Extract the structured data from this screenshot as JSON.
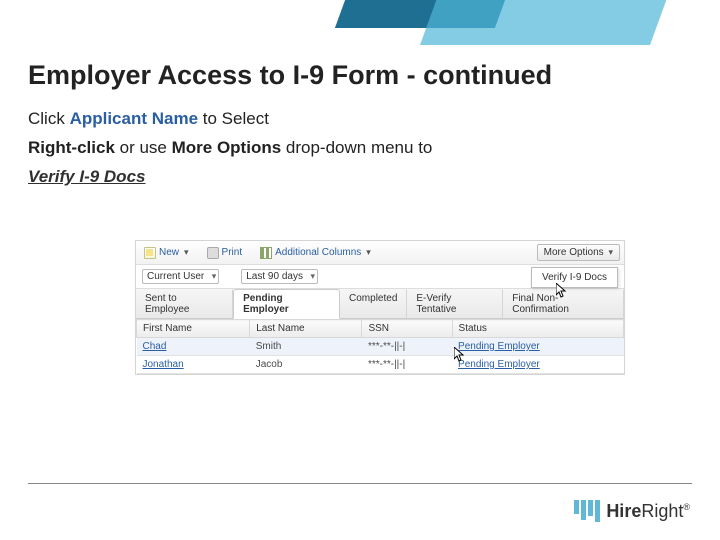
{
  "header": {
    "title": "Employer Access to I-9 Form - continued"
  },
  "instructions": {
    "line1_prefix": "Click ",
    "applicant_name": "Applicant Name",
    "line1_suffix": " to Select",
    "right_click": "Right-click",
    "line2_mid": " or use ",
    "more_options": "More Options",
    "line2_suffix": " drop-down menu to",
    "verify": "Verify I-9 Docs"
  },
  "app": {
    "toolbar": {
      "new_label": "New",
      "print_label": "Print",
      "columns_label": "Additional Columns",
      "more_label": "More Options"
    },
    "dropdown_item": "Verify I-9 Docs",
    "filters": {
      "user": "Current User",
      "range": "Last 90 days"
    },
    "tabs": [
      {
        "label": "Sent to Employee",
        "active": false
      },
      {
        "label": "Pending Employer",
        "active": true
      },
      {
        "label": "Completed",
        "active": false
      },
      {
        "label": "E-Verify Tentative",
        "active": false
      },
      {
        "label": "Final Non-Confirmation",
        "active": false
      }
    ],
    "table": {
      "headers": [
        "First Name",
        "Last Name",
        "SSN",
        "Status"
      ],
      "rows": [
        {
          "first": "Chad",
          "last": "Smith",
          "ssn": "***-**-||-|",
          "status": "Pending Employer",
          "selected": true
        },
        {
          "first": "Jonathan",
          "last": "Jacob",
          "ssn": "***-**-||-|",
          "status": "Pending Employer",
          "selected": false
        }
      ]
    }
  },
  "logo": {
    "word_bold": "Hire",
    "word_rest": "Right"
  }
}
